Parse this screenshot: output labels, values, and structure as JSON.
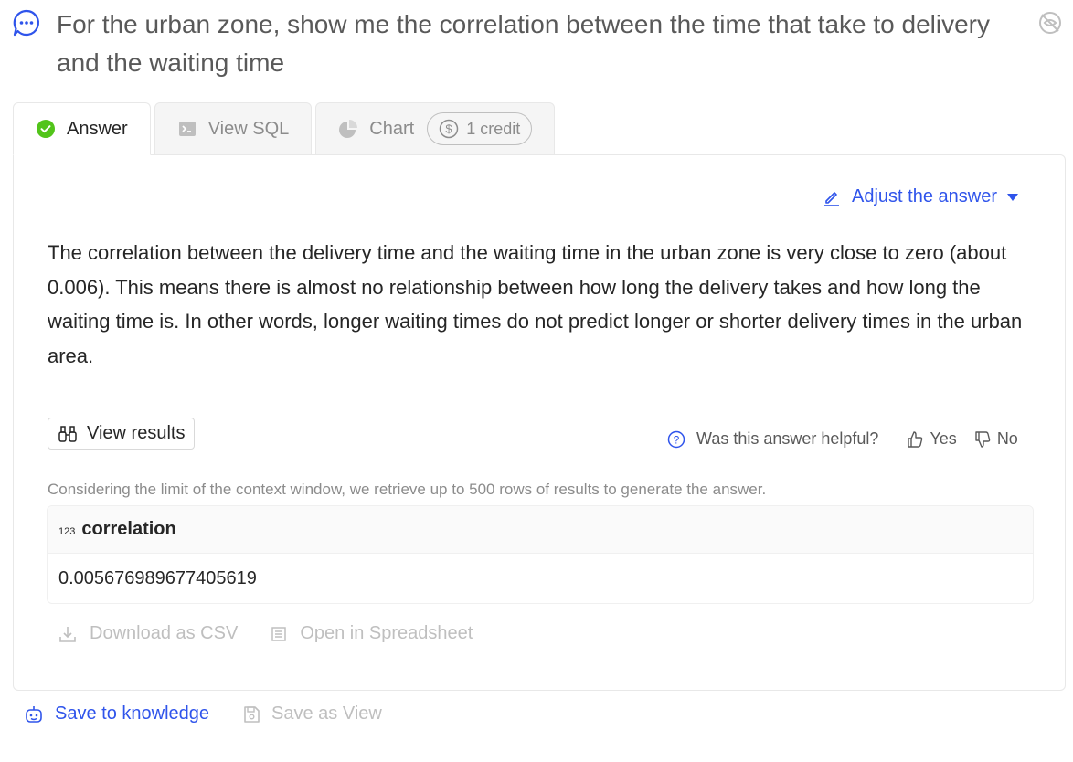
{
  "question": {
    "text": "For the urban zone, show me the correlation between the time that take to delivery and the waiting time",
    "icon": "chat-bubble-icon"
  },
  "tabs": [
    {
      "label": "Answer",
      "icon": "check-circle-icon",
      "active": true
    },
    {
      "label": "View SQL",
      "icon": "terminal-icon",
      "active": false
    },
    {
      "label": "Chart",
      "icon": "pie-chart-icon",
      "active": false,
      "badge": "1 credit"
    }
  ],
  "adjust": {
    "label": "Adjust the answer"
  },
  "answer": {
    "text": "The correlation between the delivery time and the waiting time in the urban zone is very close to zero (about 0.006). This means there is almost no relationship between how long the delivery takes and how long the waiting time is. In other words, longer waiting times do not predict longer or shorter delivery times in the urban area."
  },
  "view_results": {
    "label": "View results"
  },
  "feedback": {
    "question": "Was this answer helpful?",
    "yes": "Yes",
    "no": "No"
  },
  "notice": "Considering the limit of the context window, we retrieve up to 500 rows of results to generate the answer.",
  "table": {
    "columns": [
      {
        "type": "123",
        "name": "correlation"
      }
    ],
    "rows": [
      [
        "0.005676989677405619"
      ]
    ]
  },
  "actions": {
    "download": "Download as CSV",
    "spreadsheet": "Open in Spreadsheet"
  },
  "footer": {
    "save_knowledge": "Save to knowledge",
    "save_view": "Save as View"
  },
  "colors": {
    "accent": "#2f54eb",
    "success": "#52c41a",
    "muted": "#bfbfbf"
  }
}
